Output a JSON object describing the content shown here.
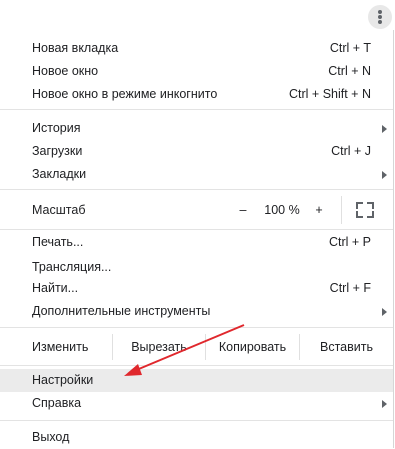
{
  "menu": {
    "new_tab": {
      "label": "Новая вкладка",
      "shortcut": "Ctrl + T"
    },
    "new_window": {
      "label": "Новое окно",
      "shortcut": "Ctrl + N"
    },
    "incognito": {
      "label": "Новое окно в режиме инкогнито",
      "shortcut": "Ctrl + Shift + N"
    },
    "history": {
      "label": "История"
    },
    "downloads": {
      "label": "Загрузки",
      "shortcut": "Ctrl + J"
    },
    "bookmarks": {
      "label": "Закладки"
    },
    "zoom": {
      "label": "Масштаб",
      "minus": "–",
      "value": "100 %",
      "plus": "+"
    },
    "print": {
      "label": "Печать...",
      "shortcut": "Ctrl + P"
    },
    "cast": {
      "label": "Трансляция..."
    },
    "find": {
      "label": "Найти...",
      "shortcut": "Ctrl + F"
    },
    "more_tools": {
      "label": "Дополнительные инструменты"
    },
    "edit": {
      "label": "Изменить",
      "cut": "Вырезать",
      "copy": "Копировать",
      "paste": "Вставить"
    },
    "settings": {
      "label": "Настройки"
    },
    "help": {
      "label": "Справка"
    },
    "exit": {
      "label": "Выход"
    }
  },
  "colors": {
    "highlight": "#ebebeb",
    "annotation_arrow": "#e0282d"
  }
}
